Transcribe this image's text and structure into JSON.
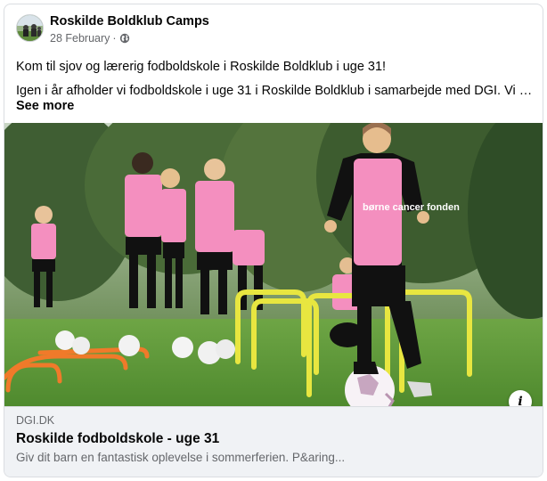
{
  "post": {
    "page_name": "Roskilde Boldklub Camps",
    "date": "28 February",
    "separator": "·",
    "audience_icon": "globe-icon",
    "text_line_1": "Kom til sjov og lærerig fodboldskole i Roskilde Boldklub i uge 31!",
    "text_line_2": "Igen i år afholder vi fodboldskole i uge 31 i Roskilde Boldklub i samarbejde med DGI. Vi fors…",
    "see_more": "See more"
  },
  "photo": {
    "jersey_text": "børne cancer fonden",
    "info_icon_glyph": "i"
  },
  "link_preview": {
    "domain": "DGI.DK",
    "title": "Roskilde fodboldskole - uge 31",
    "description": "Giv dit barn en fantastisk oplevelse i sommerferien. P&aring..."
  },
  "colors": {
    "jersey_pink": "#f48fbf",
    "hurdle_yellow": "#e8e640",
    "hurdle_orange": "#f07a2a",
    "grass": "#5f9a3a",
    "text_secondary": "#65676b",
    "preview_bg": "#f0f2f5"
  }
}
